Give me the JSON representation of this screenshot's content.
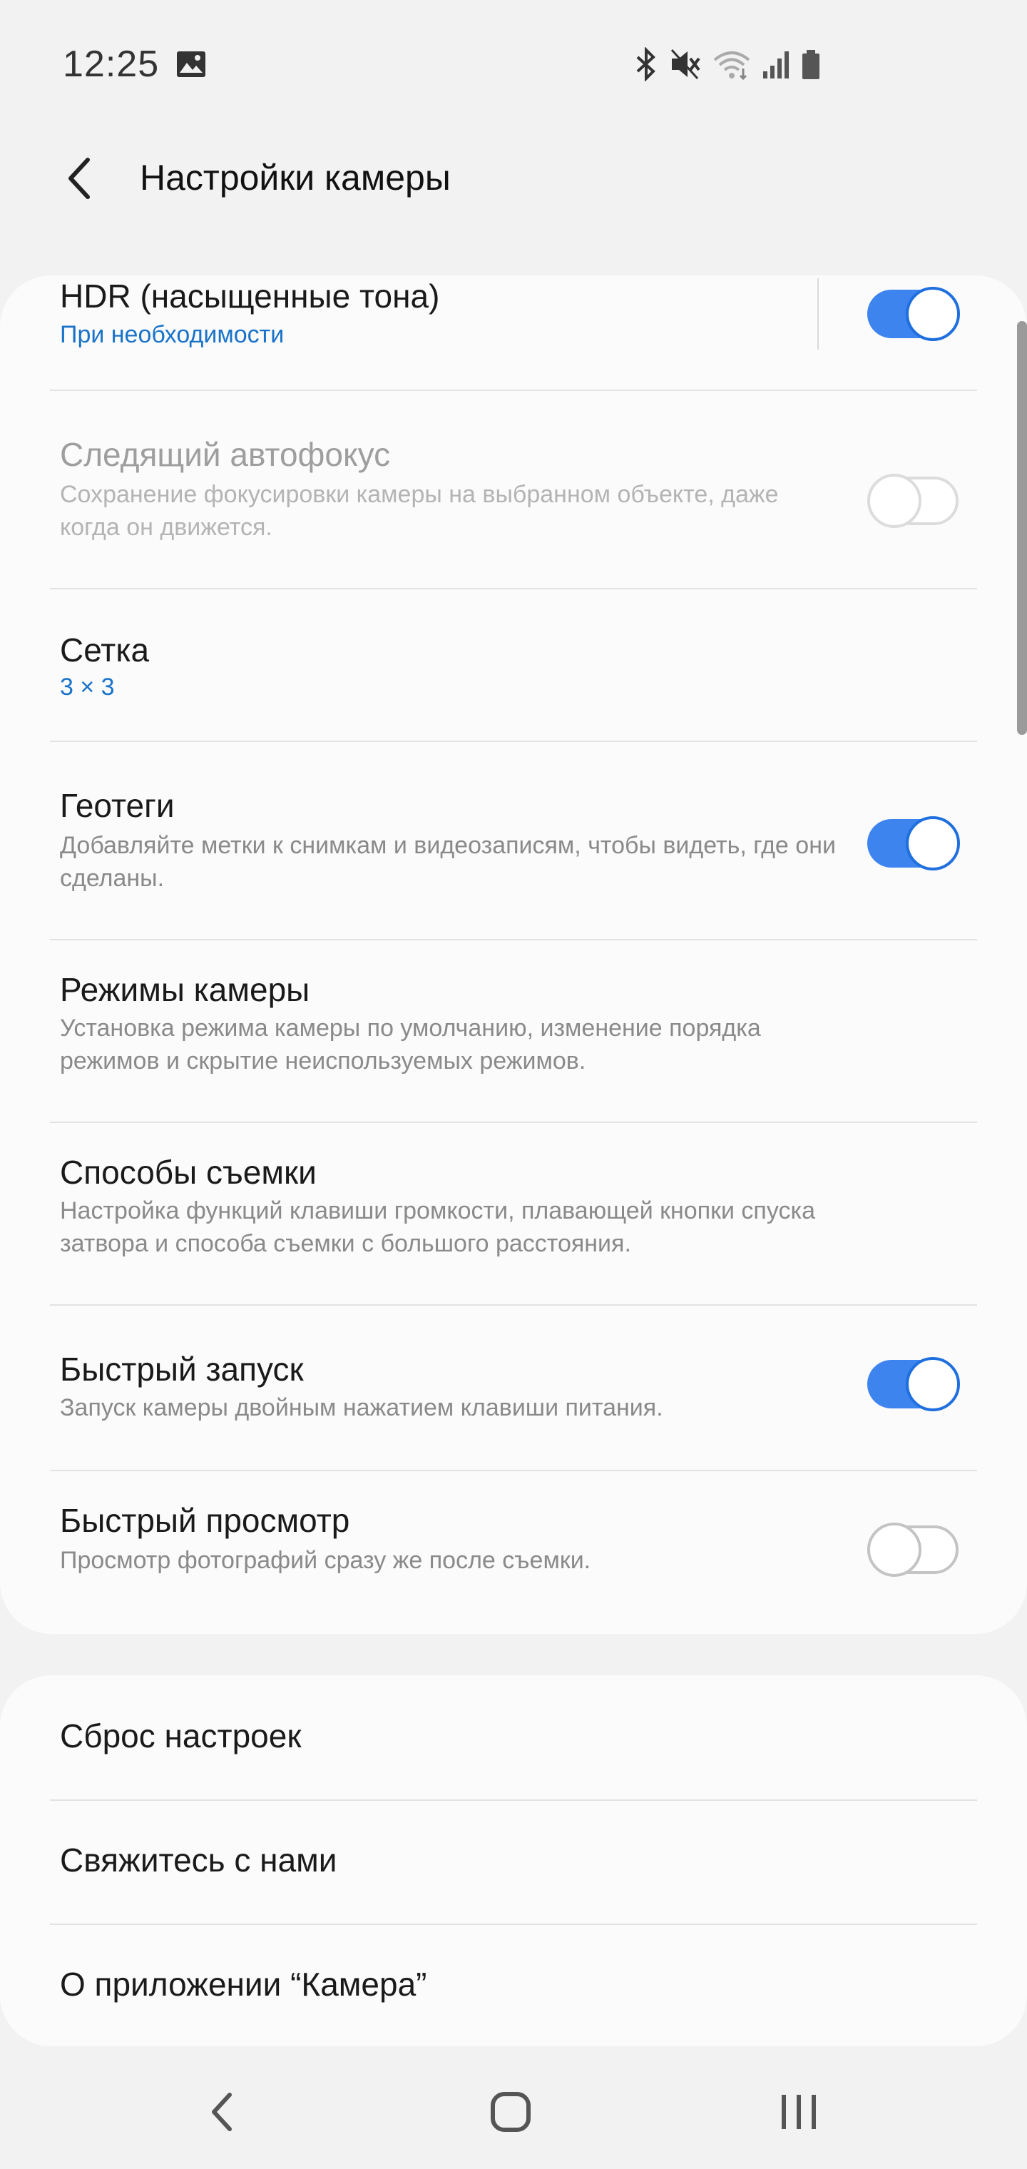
{
  "status_bar": {
    "time": "12:25",
    "icons": [
      "gallery-icon",
      "bluetooth-icon",
      "mute-icon",
      "wifi-icon",
      "signal-icon",
      "battery-icon"
    ]
  },
  "header": {
    "title": "Настройки камеры",
    "back_icon": "chevron-left-icon"
  },
  "settings": {
    "hdr": {
      "title": "HDR (насыщенные тона)",
      "subtitle": "При необходимости",
      "enabled": true
    },
    "tracking_af": {
      "title": "Следящий автофокус",
      "subtitle": "Сохранение фокусировки камеры на выбранном объекте, даже когда он движется.",
      "enabled": false,
      "disabled": true
    },
    "grid": {
      "title": "Сетка",
      "subtitle": "3 × 3"
    },
    "geotags": {
      "title": "Геотеги",
      "subtitle": "Добавляйте метки к снимкам и видеозаписям, чтобы видеть, где они сделаны.",
      "enabled": true
    },
    "camera_modes": {
      "title": "Режимы камеры",
      "subtitle": "Установка режима камеры по умолчанию, изменение порядка режимов и скрытие неиспользуемых режимов."
    },
    "shooting_methods": {
      "title": "Способы съемки",
      "subtitle": "Настройка функций клавиши громкости, плавающей кнопки спуска затвора и способа съемки с большого расстояния."
    },
    "quick_launch": {
      "title": "Быстрый запуск",
      "subtitle": "Запуск камеры двойным нажатием клавиши питания.",
      "enabled": true
    },
    "quick_review": {
      "title": "Быстрый просмотр",
      "subtitle": "Просмотр фотографий сразу же после съемки.",
      "enabled": false
    }
  },
  "extra": {
    "reset": "Сброс настроек",
    "contact": "Свяжитесь с нами",
    "about": "О приложении “Камера”"
  },
  "colors": {
    "accent": "#3e84ef",
    "link": "#1a73c8",
    "background": "#f2f2f2",
    "card": "#fbfbfb"
  },
  "nav_bar": {
    "icons": [
      "back-nav-icon",
      "home-nav-icon",
      "recents-nav-icon"
    ]
  }
}
